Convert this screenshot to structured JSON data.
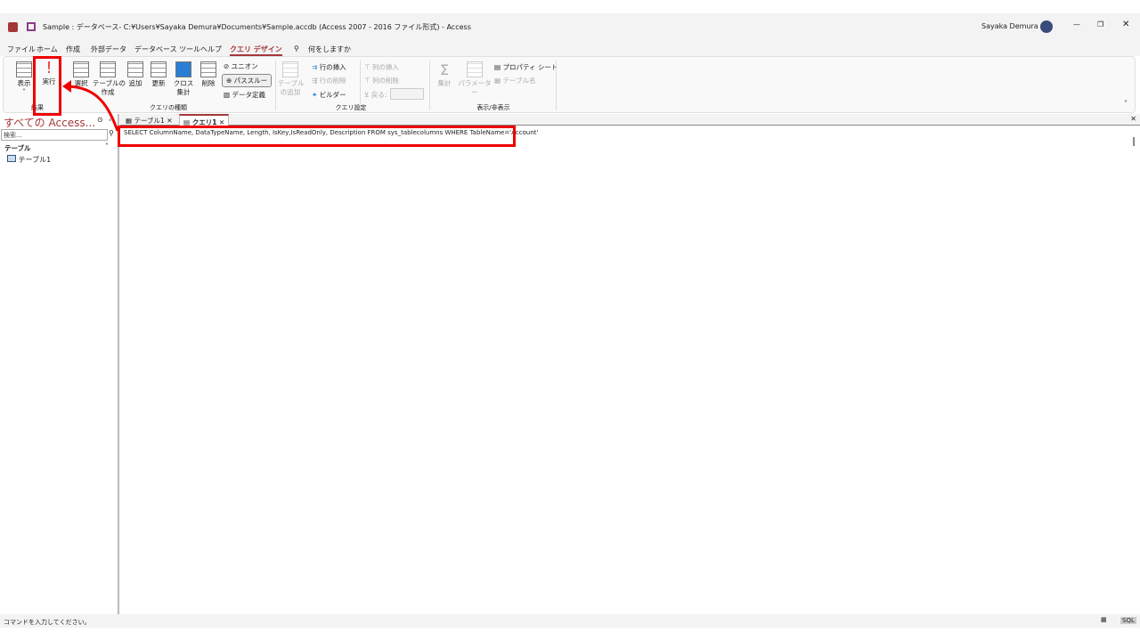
{
  "title": {
    "text": "Sample : データベース- C:¥Users¥Sayaka Demura¥Documents¥Sample.accdb (Access 2007 - 2016 ファイル形式)  -  Access",
    "user": "Sayaka Demura"
  },
  "menu": [
    "ファイル",
    "ホーム",
    "作成",
    "外部データ",
    "データベース ツール",
    "ヘルプ",
    "クエリ デザイン"
  ],
  "tell_me": "何をしますか",
  "ribbon": {
    "view": "表示",
    "run": "実行",
    "select": "選択",
    "make_table": "テーブルの\n作成",
    "append": "追加",
    "update": "更新",
    "crosstab": "クロス\n集計",
    "delete": "削除",
    "union": "ユニオン",
    "passthrough": "パススルー",
    "data_def": "データ定義",
    "add_table": "テーブル\nの追加",
    "insert_rows": "行の挿入",
    "delete_rows": "行の削除",
    "builder": "ビルダー",
    "insert_cols": "列の挿入",
    "delete_cols": "列の削除",
    "return": "戻る:",
    "totals": "集計",
    "parameters": "パラメーター",
    "property_sheet": "プロパティ シート",
    "table_names": "テーブル名",
    "groups": {
      "results": "結果",
      "query_type": "クエリの種類",
      "query_setup": "クエリ設定",
      "show_hide": "表示/非表示"
    }
  },
  "nav": {
    "title": "すべての Access...",
    "search_placeholder": "検索...",
    "section": "テーブル",
    "items": [
      "テーブル1"
    ]
  },
  "tabs": [
    "テーブル1",
    "クエリ1"
  ],
  "sql": "SELECT ColumnName, DataTypeName, Length, IsKey,IsReadOnly, Description FROM sys_tablecolumns WHERE TableName='Account'",
  "status": {
    "text": "コマンドを入力してください。",
    "sql": "SQL"
  },
  "colors": {
    "accent": "#a4373a",
    "highlight": "#e00000"
  }
}
